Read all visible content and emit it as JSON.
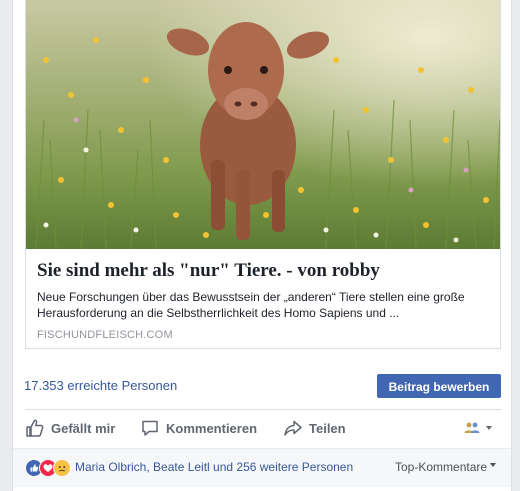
{
  "link_preview": {
    "image": "calf-in-meadow-photo",
    "title": "Sie sind mehr als \"nur\" Tiere. - von robby",
    "description": "Neue Forschungen über das Bewusstsein der „anderen“ Tiere stellen eine große Herausforderung an die Selbstherrlichkeit des Homo Sapiens und ...",
    "domain": "FISCHUNDFLEISCH.COM"
  },
  "stats": {
    "reach": "17.353 erreichte Personen",
    "boost_label": "Beitrag bewerben"
  },
  "actions": {
    "like": {
      "label": "Gefällt mir",
      "icon": "thumbs-up-icon"
    },
    "comment": {
      "label": "Kommentieren",
      "icon": "comment-icon"
    },
    "share": {
      "label": "Teilen",
      "icon": "share-icon"
    },
    "audience_icon": "friends-audience-icon"
  },
  "reactions": {
    "icons": [
      "like-reaction-icon",
      "love-reaction-icon",
      "sad-reaction-icon"
    ],
    "summary": "Maria Olbrich, Beate Leitl und 256 weitere Personen",
    "sort_label": "Top-Kommentare"
  },
  "colors": {
    "link": "#365899",
    "button": "#4267b2",
    "action_text": "#606770",
    "muted": "#90949c"
  }
}
